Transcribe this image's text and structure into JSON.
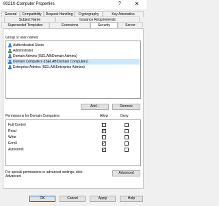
{
  "window": {
    "title": "8021X-Computer Properties",
    "help_glyph": "?",
    "close_glyph": "✕"
  },
  "tabs": {
    "row1": [
      "General",
      "Compatibility",
      "Request Handling",
      "Cryptography",
      "Key Attestation"
    ],
    "row2": [
      "Subject Name",
      "Issuance Requirements"
    ],
    "row3": [
      "Superseded Templates",
      "Extensions",
      "Security",
      "Server"
    ],
    "active": "Security"
  },
  "security": {
    "group_label": "Group or user names:",
    "principals": [
      {
        "name": "Authenticated Users",
        "icon": "user-group-icon",
        "selected": false
      },
      {
        "name": "Administrator",
        "icon": "user-icon",
        "selected": false
      },
      {
        "name": "Domain Admins (ISELAB\\Domain Admins)",
        "icon": "user-group-icon",
        "selected": false
      },
      {
        "name": "Domain Computers (ISELAB\\Domain Computers)",
        "icon": "user-group-icon",
        "selected": true
      },
      {
        "name": "Enterprise Admins (ISELAB\\Enterprise Admins)",
        "icon": "user-group-icon",
        "selected": false
      }
    ],
    "add_label": "Add...",
    "remove_label": "Remove",
    "permissions_label": "Permissions for Domain Computers",
    "allow_header": "Allow",
    "deny_header": "Deny",
    "permissions": [
      {
        "name": "Full Control",
        "allow": false,
        "deny": false
      },
      {
        "name": "Read",
        "allow": true,
        "deny": false
      },
      {
        "name": "Write",
        "allow": false,
        "deny": false
      },
      {
        "name": "Enroll",
        "allow": true,
        "deny": false
      },
      {
        "name": "Autoenroll",
        "allow": true,
        "deny": false
      }
    ],
    "check_glyph": "✓",
    "advanced_note_line1": "For special permissions or advanced settings, click",
    "advanced_note_line2": "Advanced.",
    "advanced_label": "Advanced"
  },
  "footer": {
    "ok_label": "OK",
    "cancel_label": "Cancel",
    "apply_label": "Apply",
    "help_label": "Help"
  }
}
